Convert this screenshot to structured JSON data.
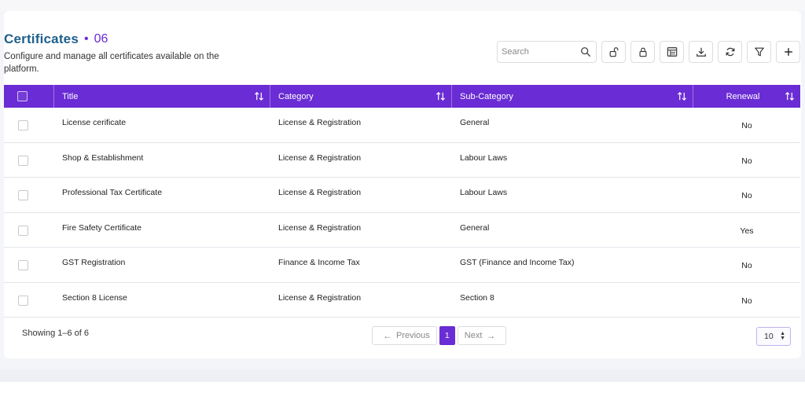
{
  "header": {
    "title": "Certificates",
    "separator": "•",
    "count": "06",
    "subtitle": "Configure and manage all certificates available on the platform."
  },
  "toolbar": {
    "search_placeholder": "Search",
    "buttons": [
      "unlock-icon",
      "lock-icon",
      "table-icon",
      "download-icon",
      "refresh-icon",
      "filter-icon",
      "plus-icon"
    ]
  },
  "table": {
    "columns": [
      "Title",
      "Category",
      "Sub-Category",
      "Renewal"
    ],
    "rows": [
      {
        "title": "License cerificate",
        "category": "License & Registration",
        "sub_category": "General",
        "renewal": "No"
      },
      {
        "title": "Shop & Establishment",
        "category": "License & Registration",
        "sub_category": "Labour Laws",
        "renewal": "No"
      },
      {
        "title": "Professional Tax Certificate",
        "category": "License & Registration",
        "sub_category": "Labour Laws",
        "renewal": "No"
      },
      {
        "title": "Fire Safety Certificate",
        "category": "License & Registration",
        "sub_category": "General",
        "renewal": "Yes"
      },
      {
        "title": "GST Registration",
        "category": "Finance & Income Tax",
        "sub_category": "GST (Finance and Income Tax)",
        "renewal": "No"
      },
      {
        "title": "Section 8 License",
        "category": "License & Registration",
        "sub_category": "Section 8",
        "renewal": "No"
      }
    ]
  },
  "footer": {
    "showing": "Showing 1–6 of 6",
    "previous": "Previous",
    "next": "Next",
    "current_page": "1",
    "per_page": "10"
  },
  "colors": {
    "accent": "#6a2cd4",
    "title": "#1d5f8c"
  }
}
